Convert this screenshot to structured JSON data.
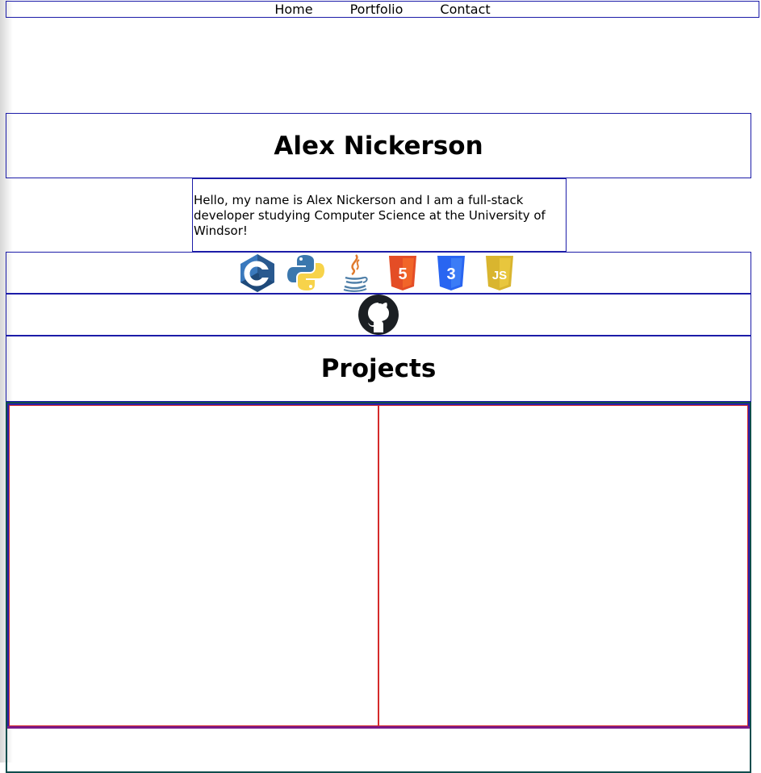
{
  "nav": {
    "items": [
      "Home",
      "Portfolio",
      "Contact"
    ]
  },
  "header": {
    "name": "Alex Nickerson"
  },
  "intro": {
    "text": "Hello, my name is Alex Nickerson and I am a full-stack developer studying Computer Science at the University of Windsor!"
  },
  "skills": [
    {
      "icon": "c-language-icon",
      "color": "#2f6fb7"
    },
    {
      "icon": "python-icon",
      "color": "#3b7bbf"
    },
    {
      "icon": "java-icon",
      "color": "#e07a2c"
    },
    {
      "icon": "html5-icon",
      "color": "#e44d26"
    },
    {
      "icon": "css3-icon",
      "color": "#2965f1"
    },
    {
      "icon": "javascript-icon",
      "color": "#d9b52f"
    }
  ],
  "social": {
    "icon": "github-icon",
    "color": "#1b1f23"
  },
  "projects": {
    "heading": "Projects",
    "cards": [
      {},
      {}
    ]
  }
}
